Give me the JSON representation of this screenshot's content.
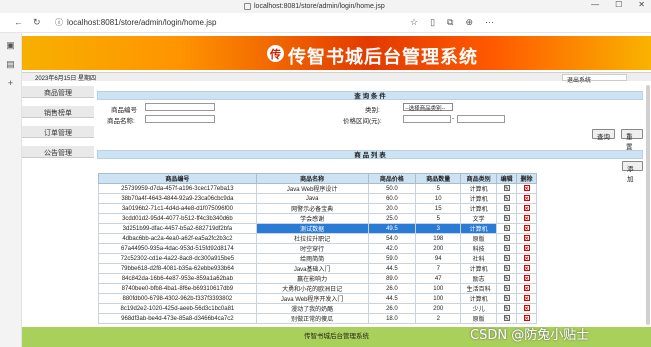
{
  "browser": {
    "tab_title": "localhost:8081/store/admin/login/home.jsp",
    "url": "localhost:8081/store/admin/login/home.jsp",
    "win": [
      "—",
      "☐",
      "✕"
    ]
  },
  "banner": {
    "title": "传智书城后台管理系统",
    "logo": "传"
  },
  "datebar": {
    "date": "2023年6月15日 星期四",
    "logout": "退出系统"
  },
  "menu": [
    "商品管理",
    "销售榜单",
    "订单管理",
    "公告管理"
  ],
  "query": {
    "head": "查 询 条 件",
    "id_label": "商品编号",
    "category_label": "类别:",
    "category_value": "--选择商品类别--",
    "name_label": "商品名称:",
    "price_label": "价格区间(元):",
    "search": "查询",
    "reset": "重置"
  },
  "list": {
    "head": "商 品 列 表",
    "add": "添加",
    "columns": [
      "商品编号",
      "商品名称",
      "商品价格",
      "商品数量",
      "商品类别",
      "编辑",
      "删除"
    ],
    "rows": [
      [
        "25739959-d7da-457f-a196-3cec177eba13",
        "Java Web程序设计",
        "50.0",
        "5",
        "计算机"
      ],
      [
        "38b70a4f-4643-4844-92a9-23ca06cbc9da",
        "Java",
        "60.0",
        "10",
        "计算机"
      ],
      [
        "3a0196b2-71c1-4d4d-a4e8-d1f075096f00",
        "网警示必备宝典",
        "20.0",
        "15",
        "计算机"
      ],
      [
        "3cdd01d2-95d4-4077-b512-ff4c3b340d6b",
        "学会感谢",
        "25.0",
        "5",
        "文学"
      ],
      [
        "3d251b99-dfac-4457-b5a2-682719df2bfa",
        "测试数据",
        "49.5",
        "3",
        "计算机"
      ],
      [
        "4dbac6bb-ac2a-4ea0-a62f-ea5a2fc2b3c2",
        "杜拉拉升职记",
        "54.0",
        "198",
        "原版"
      ],
      [
        "67a44950-935a-4dac-953d-515fd92d8174",
        "时空穿行",
        "42.0",
        "200",
        "科技"
      ],
      [
        "72c52302-cd1e-4a22-8ac8-dc300a915be5",
        "给雨简简",
        "59.0",
        "94",
        "社科"
      ],
      [
        "79bbe618-d2f8-4081-b35a-62ebbe933b64",
        "Java基础入门",
        "44.5",
        "7",
        "计算机"
      ],
      [
        "84c842da-16b6-4e87-953e-859a1a62bab",
        "赢在影响力",
        "89.0",
        "47",
        "励志"
      ],
      [
        "8740bee0-bfb8-4ba1-8f6e-b69310617db9",
        "大勇和小花的欧洲日记",
        "26.0",
        "100",
        "生活百科"
      ],
      [
        "880fdb00-6798-4302-962b-f337f3393802",
        "Java Web程序开发入门",
        "44.5",
        "100",
        "计算机"
      ],
      [
        "8c19d2e2-1020-425d-aeeb-56d3c1bc0a81",
        "漫动了我的奶酪",
        "26.0",
        "200",
        "少儿"
      ],
      [
        "968df3ab-be4d-473e-85a8-d3466b4ca7c2",
        "别做正常的傻瓜",
        "18.0",
        "2",
        "原版"
      ]
    ],
    "edit_icon": "✎",
    "delete_icon": "✕"
  },
  "footer": "传智书城后台管理系统",
  "watermark": "CSDN @防兔小贴士"
}
